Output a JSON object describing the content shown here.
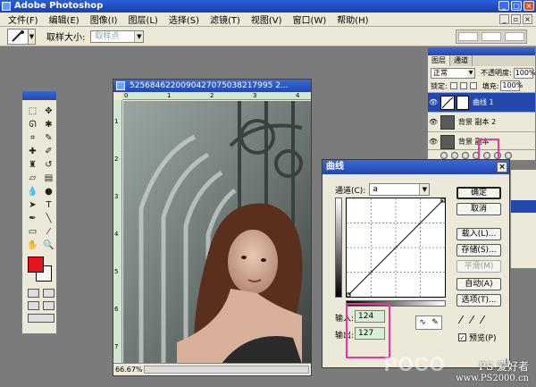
{
  "app": {
    "title": "Adobe Photoshop"
  },
  "menu": {
    "items": [
      "文件(F)",
      "编辑(E)",
      "图像(I)",
      "图层(L)",
      "选择(S)",
      "滤镜(T)",
      "视图(V)",
      "窗口(W)",
      "帮助(H)"
    ]
  },
  "options": {
    "sample_size_label": "取样大小:",
    "sample_size_value": "取样点"
  },
  "document": {
    "title": "5256846220090427075038217995 2...",
    "zoom": "66.67%",
    "ruler_top": [
      "0",
      "1",
      "2",
      "3",
      "4"
    ],
    "ruler_left": [
      "1",
      "2",
      "3",
      "4",
      "5",
      "6",
      "7"
    ]
  },
  "layers": {
    "tabs": [
      "图层",
      "通道"
    ],
    "blend_mode": "正常",
    "opacity_label": "不透明度:",
    "opacity_value": "100%",
    "lock_label": "锁定:",
    "fill_label": "填充:",
    "fill_value": "100%",
    "rows": [
      {
        "name": "曲线 1",
        "selected": true
      },
      {
        "name": "背景 副本 2",
        "selected": false
      },
      {
        "name": "背景 副本",
        "selected": false
      }
    ]
  },
  "curves": {
    "title": "曲线",
    "channel_label": "通道(C):",
    "channel_value": "a",
    "input_label": "输入:",
    "input_value": "124",
    "output_label": "输出:",
    "output_value": "127",
    "buttons": {
      "ok": "确定",
      "cancel": "取消",
      "load": "载入(L)...",
      "save": "存储(S)...",
      "smooth": "平滑(M)",
      "auto": "自动(A)",
      "options": "选项(T)..."
    },
    "preview_label": "预览(P)"
  },
  "watermark": {
    "poco": "POCO",
    "line1": "PS 爱好者",
    "line2": "www.PS2000.cn"
  },
  "colors": {
    "title_blue": "#2247ad",
    "foreground_color": "#e8141c",
    "highlight_pink": "#e43a9a",
    "io_green": "#d6f0d6"
  }
}
